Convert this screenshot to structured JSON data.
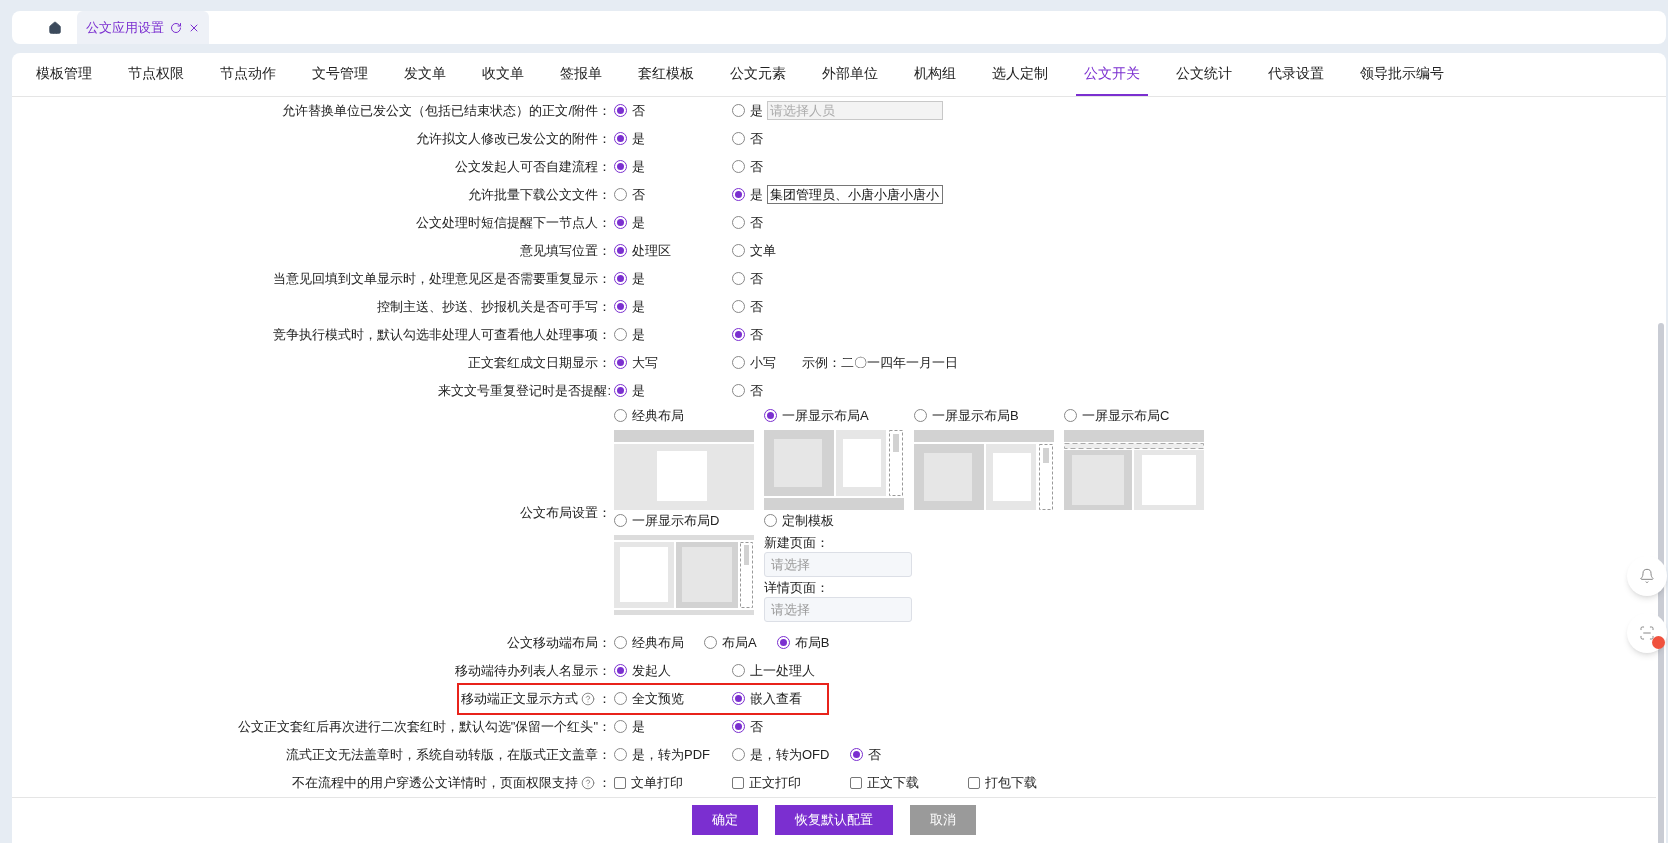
{
  "page_tabs": [
    {
      "label": "公文应用设置",
      "selected": true
    }
  ],
  "nav_tabs": [
    {
      "label": "模板管理",
      "selected": false
    },
    {
      "label": "节点权限",
      "selected": false
    },
    {
      "label": "节点动作",
      "selected": false
    },
    {
      "label": "文号管理",
      "selected": false
    },
    {
      "label": "发文单",
      "selected": false
    },
    {
      "label": "收文单",
      "selected": false
    },
    {
      "label": "签报单",
      "selected": false
    },
    {
      "label": "套红模板",
      "selected": false
    },
    {
      "label": "公文元素",
      "selected": false
    },
    {
      "label": "外部单位",
      "selected": false
    },
    {
      "label": "机构组",
      "selected": false
    },
    {
      "label": "选人定制",
      "selected": false
    },
    {
      "label": "公文开关",
      "selected": true
    },
    {
      "label": "公文统计",
      "selected": false
    },
    {
      "label": "代录设置",
      "selected": false
    },
    {
      "label": "领导批示编号",
      "selected": false
    }
  ],
  "settings": [
    {
      "kind": "radio",
      "label": "允许替换单位已发公文（包括已结束状态）的正文/附件：",
      "options": [
        {
          "label": "否",
          "selected": true
        },
        {
          "label": "是",
          "selected": false
        }
      ],
      "field": {
        "placeholder": "请选择人员",
        "disabled": true
      }
    },
    {
      "kind": "radio",
      "label": "允许拟文人修改已发公文的附件：",
      "options": [
        {
          "label": "是",
          "selected": true
        },
        {
          "label": "否",
          "selected": false
        }
      ]
    },
    {
      "kind": "radio",
      "label": "公文发起人可否自建流程：",
      "options": [
        {
          "label": "是",
          "selected": true
        },
        {
          "label": "否",
          "selected": false
        }
      ]
    },
    {
      "kind": "radio",
      "label": "允许批量下载公文文件：",
      "options": [
        {
          "label": "否",
          "selected": false
        },
        {
          "label": "是",
          "selected": true
        }
      ],
      "field": {
        "value": "集团管理员、小唐小唐小唐小",
        "disabled": false
      }
    },
    {
      "kind": "radio",
      "label": "公文处理时短信提醒下一节点人：",
      "options": [
        {
          "label": "是",
          "selected": true
        },
        {
          "label": "否",
          "selected": false
        }
      ]
    },
    {
      "kind": "radio",
      "label": "意见填写位置：",
      "options": [
        {
          "label": "处理区",
          "selected": true
        },
        {
          "label": "文单",
          "selected": false
        }
      ]
    },
    {
      "kind": "radio",
      "label": "当意见回填到文单显示时，处理意见区是否需要重复显示：",
      "options": [
        {
          "label": "是",
          "selected": true
        },
        {
          "label": "否",
          "selected": false
        }
      ]
    },
    {
      "kind": "radio",
      "label": "控制主送、抄送、抄报机关是否可手写：",
      "options": [
        {
          "label": "是",
          "selected": true
        },
        {
          "label": "否",
          "selected": false
        }
      ]
    },
    {
      "kind": "radio",
      "label": "竞争执行模式时，默认勾选非处理人可查看他人处理事项：",
      "options": [
        {
          "label": "是",
          "selected": false
        },
        {
          "label": "否",
          "selected": true
        }
      ]
    },
    {
      "kind": "radio",
      "label": "正文套红成文日期显示：",
      "options": [
        {
          "label": "大写",
          "selected": true
        },
        {
          "label": "小写",
          "selected": false
        }
      ],
      "note": "示例：二〇一四年一月一日"
    },
    {
      "kind": "radio",
      "label": "来文文号重复登记时是否提醒:",
      "options": [
        {
          "label": "是",
          "selected": true
        },
        {
          "label": "否",
          "selected": false
        }
      ]
    },
    {
      "kind": "layout",
      "label": "公文布局设置：",
      "options": [
        {
          "kind": "classic",
          "label": "经典布局",
          "selected": false
        },
        {
          "kind": "a",
          "label": "一屏显示布局A",
          "selected": true
        },
        {
          "kind": "b",
          "label": "一屏显示布局B",
          "selected": false
        },
        {
          "kind": "c",
          "label": "一屏显示布局C",
          "selected": false
        },
        {
          "kind": "d",
          "label": "一屏显示布局D",
          "selected": false
        },
        {
          "kind": "custom",
          "label": "定制模板",
          "selected": false,
          "fields": [
            {
              "label": "新建页面：",
              "placeholder": "请选择"
            },
            {
              "label": "详情页面：",
              "placeholder": "请选择"
            }
          ]
        }
      ]
    },
    {
      "kind": "radio-inline",
      "label": "公文移动端布局：",
      "options": [
        {
          "label": "经典布局",
          "selected": false
        },
        {
          "label": "布局A",
          "selected": false
        },
        {
          "label": "布局B",
          "selected": true
        }
      ]
    },
    {
      "kind": "radio",
      "label": "移动端待办列表人名显示：",
      "options": [
        {
          "label": "发起人",
          "selected": true
        },
        {
          "label": "上一处理人",
          "selected": false
        }
      ]
    },
    {
      "kind": "radio",
      "label": "移动端正文显示方式",
      "help": true,
      "colon": "：",
      "highlighted": true,
      "options": [
        {
          "label": "全文预览",
          "selected": false
        },
        {
          "label": "嵌入查看",
          "selected": true
        }
      ]
    },
    {
      "kind": "radio",
      "label": "公文正文套红后再次进行二次套红时，默认勾选\"保留一个红头\"：",
      "options": [
        {
          "label": "是",
          "selected": false
        },
        {
          "label": "否",
          "selected": true
        }
      ]
    },
    {
      "kind": "radio",
      "label": "流式正文无法盖章时，系统自动转版，在版式正文盖章：",
      "options": [
        {
          "label": "是，转为PDF",
          "selected": false
        },
        {
          "label": "是，转为OFD",
          "selected": false
        },
        {
          "label": "否",
          "selected": true
        }
      ]
    },
    {
      "kind": "checkbox",
      "label": "不在流程中的用户穿透公文详情时，页面权限支持",
      "help": true,
      "colon": "：",
      "options": [
        {
          "label": "文单打印",
          "checked": false
        },
        {
          "label": "正文打印",
          "checked": false
        },
        {
          "label": "正文下载",
          "checked": false
        },
        {
          "label": "打包下载",
          "checked": false
        }
      ]
    }
  ],
  "buttons": [
    {
      "label": "确定",
      "kind": "primary"
    },
    {
      "label": "恢复默认配置",
      "kind": "primary"
    },
    {
      "label": "取消",
      "kind": "secondary"
    }
  ]
}
